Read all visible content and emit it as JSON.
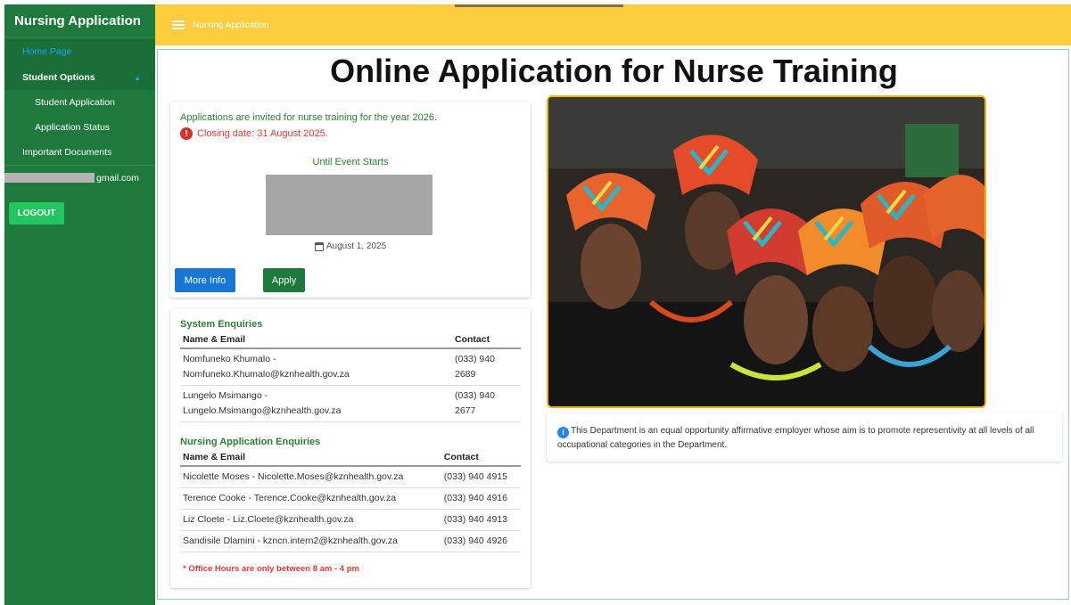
{
  "sidebar": {
    "brand": "Nursing Application",
    "home": "Home Page",
    "student_options": "Student Options",
    "student_application": "Student Application",
    "application_status": "Application Status",
    "important_documents": "Important Documents",
    "user_email_suffix": "gmail.com",
    "logout": "LOGOUT"
  },
  "topbar": {
    "title": "Nursing Application"
  },
  "main": {
    "title": "Online Application for Nurse Training",
    "invite": "Applications are invited for nurse training for the year 2026.",
    "closing": "Closing date: 31 August 2025.",
    "until": "Until Event Starts",
    "event_date": "August 1, 2025",
    "more_info": "More Info",
    "apply": "Apply",
    "system_enquiries": {
      "title": "System Enquiries",
      "headers": [
        "Name & Email",
        "Contact"
      ],
      "rows": [
        [
          "Nomfuneko Khumalo - Nomfuneko.Khumalo@kznhealth.gov.za",
          "(033) 940 2689"
        ],
        [
          "Lungelo Msimango - Lungelo.Msimango@kznhealth.gov.za",
          "(033) 940 2677"
        ]
      ]
    },
    "nursing_enquiries": {
      "title": "Nursing Application Enquiries",
      "headers": [
        "Name & Email",
        "Contact"
      ],
      "rows": [
        [
          "Nicolette Moses - Nicolette.Moses@kznhealth.gov.za",
          "(033) 940 4915"
        ],
        [
          "Terence Cooke - Terence.Cooke@kznhealth.gov.za",
          "(033) 940 4916"
        ],
        [
          "Liz Cloete - Liz.Cloete@kznhealth.gov.za",
          "(033) 940 4913"
        ],
        [
          "Sandisile Dlamini - kzncn.intern2@kznhealth.gov.za",
          "(033) 940 4926"
        ]
      ]
    },
    "office_hours": "* Office Hours are only between 8 am - 4 pm",
    "notice": "This Department is an equal opportunity affirmative employer whose aim is to promote representivity at all levels of all occupational categories in the Department."
  },
  "colors": {
    "sidebar": "#1e7a3c",
    "topbar": "#fccd3c",
    "accent_blue": "#1976d2",
    "accent_green": "#2e7d32",
    "alert_red": "#e53935",
    "logout_green": "#22c55e"
  },
  "icons": [
    "hamburger-menu-icon",
    "chevron-up-icon",
    "warning-icon",
    "calendar-icon",
    "info-icon"
  ]
}
